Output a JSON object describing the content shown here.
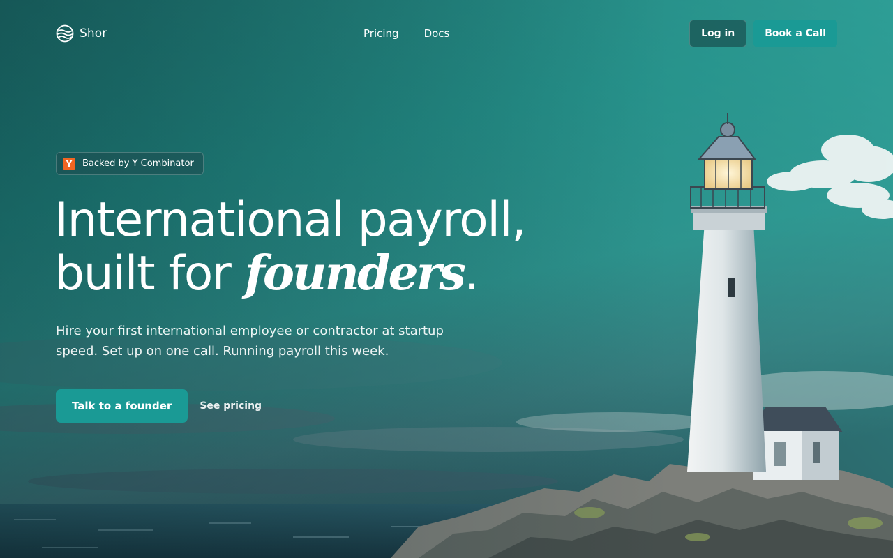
{
  "brand": {
    "name": "Shor",
    "logo_icon": "wave-globe-icon"
  },
  "nav": {
    "links": [
      {
        "label": "Pricing"
      },
      {
        "label": "Docs"
      }
    ],
    "login_label": "Log in",
    "book_label": "Book a Call"
  },
  "hero": {
    "badge": {
      "logo_letter": "Y",
      "text": "Backed by Y Combinator"
    },
    "headline_line1": "International payroll,",
    "headline_line2_prefix": "built for ",
    "headline_accent": "founders",
    "headline_suffix": ".",
    "subtext": "Hire your first international employee or contractor at startup speed. Set up on one call. Running payroll this week.",
    "primary_cta": "Talk to a founder",
    "secondary_cta": "See pricing"
  },
  "colors": {
    "accent": "#1a9a95",
    "yc_orange": "#f26522",
    "sky": "#1f7d78"
  }
}
